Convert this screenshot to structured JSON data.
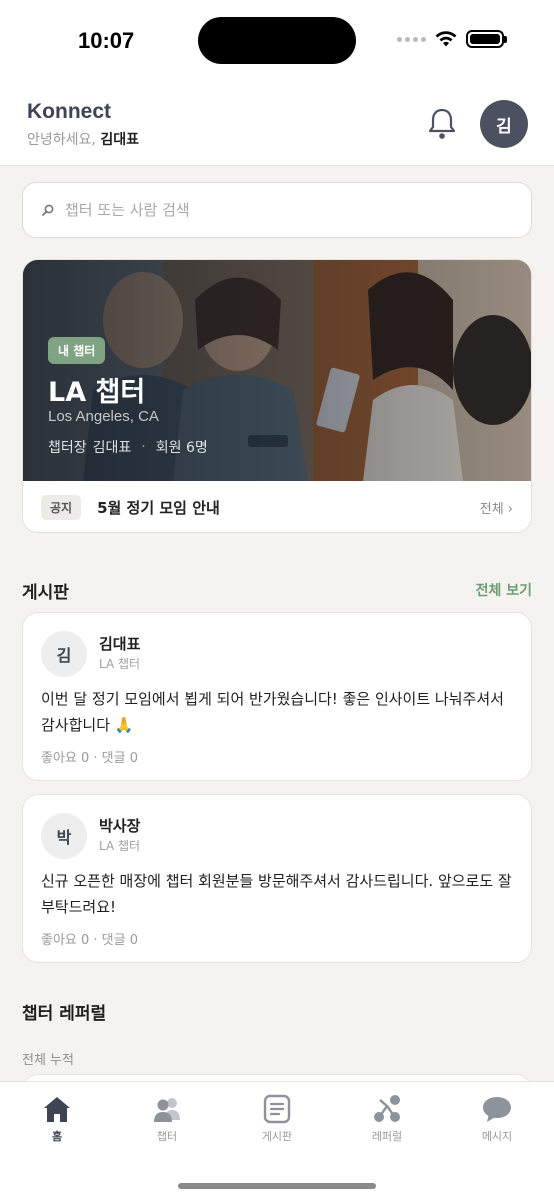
{
  "status_bar": {
    "time": "10:07"
  },
  "header": {
    "brand": "Konnect",
    "greeting_prefix": "안녕하세요,",
    "user_name": "김대표",
    "avatar_initial": "김"
  },
  "search": {
    "placeholder": "챕터 또는 사람 검색"
  },
  "hero": {
    "badge": "내 챕터",
    "title": "LA 챕터",
    "location": "Los Angeles, CA",
    "leader_label": "챕터장",
    "leader_name": "김대표",
    "separator": "·",
    "members": "회원 6명",
    "notice_tag": "공지",
    "notice_text": "5월 정기 모임 안내",
    "notice_all": "전체 ›"
  },
  "board": {
    "title": "게시판",
    "view_all": "전체 보기",
    "posts": [
      {
        "initial": "김",
        "author": "김대표",
        "chapter": "LA 챕터",
        "body": "이번 달 정기 모임에서 뵙게 되어 반가웠습니다! 좋은 인사이트 나눠주셔서 감사합니다 🙏",
        "stats": "좋아요 0 · 댓글 0"
      },
      {
        "initial": "박",
        "author": "박사장",
        "chapter": "LA 챕터",
        "body": "신규 오픈한 매장에 챕터 회원분들 방문해주셔서 감사드립니다. 앞으로도 잘 부탁드려요!",
        "stats": "좋아요 0 · 댓글 0"
      }
    ]
  },
  "referral": {
    "title": "챕터 레퍼럴",
    "subtitle": "전체 누적"
  },
  "tabs": [
    {
      "label": "홈",
      "icon": "home-icon",
      "active": true
    },
    {
      "label": "챕터",
      "icon": "people-icon",
      "active": false
    },
    {
      "label": "게시판",
      "icon": "board-icon",
      "active": false
    },
    {
      "label": "레퍼럴",
      "icon": "referral-icon",
      "active": false
    },
    {
      "label": "메시지",
      "icon": "chat-icon",
      "active": false
    }
  ],
  "colors": {
    "accent_green": "#7fa383",
    "link_green": "#6e9c73",
    "avatar_dark": "#4b5160",
    "background": "#f5f3ef"
  }
}
